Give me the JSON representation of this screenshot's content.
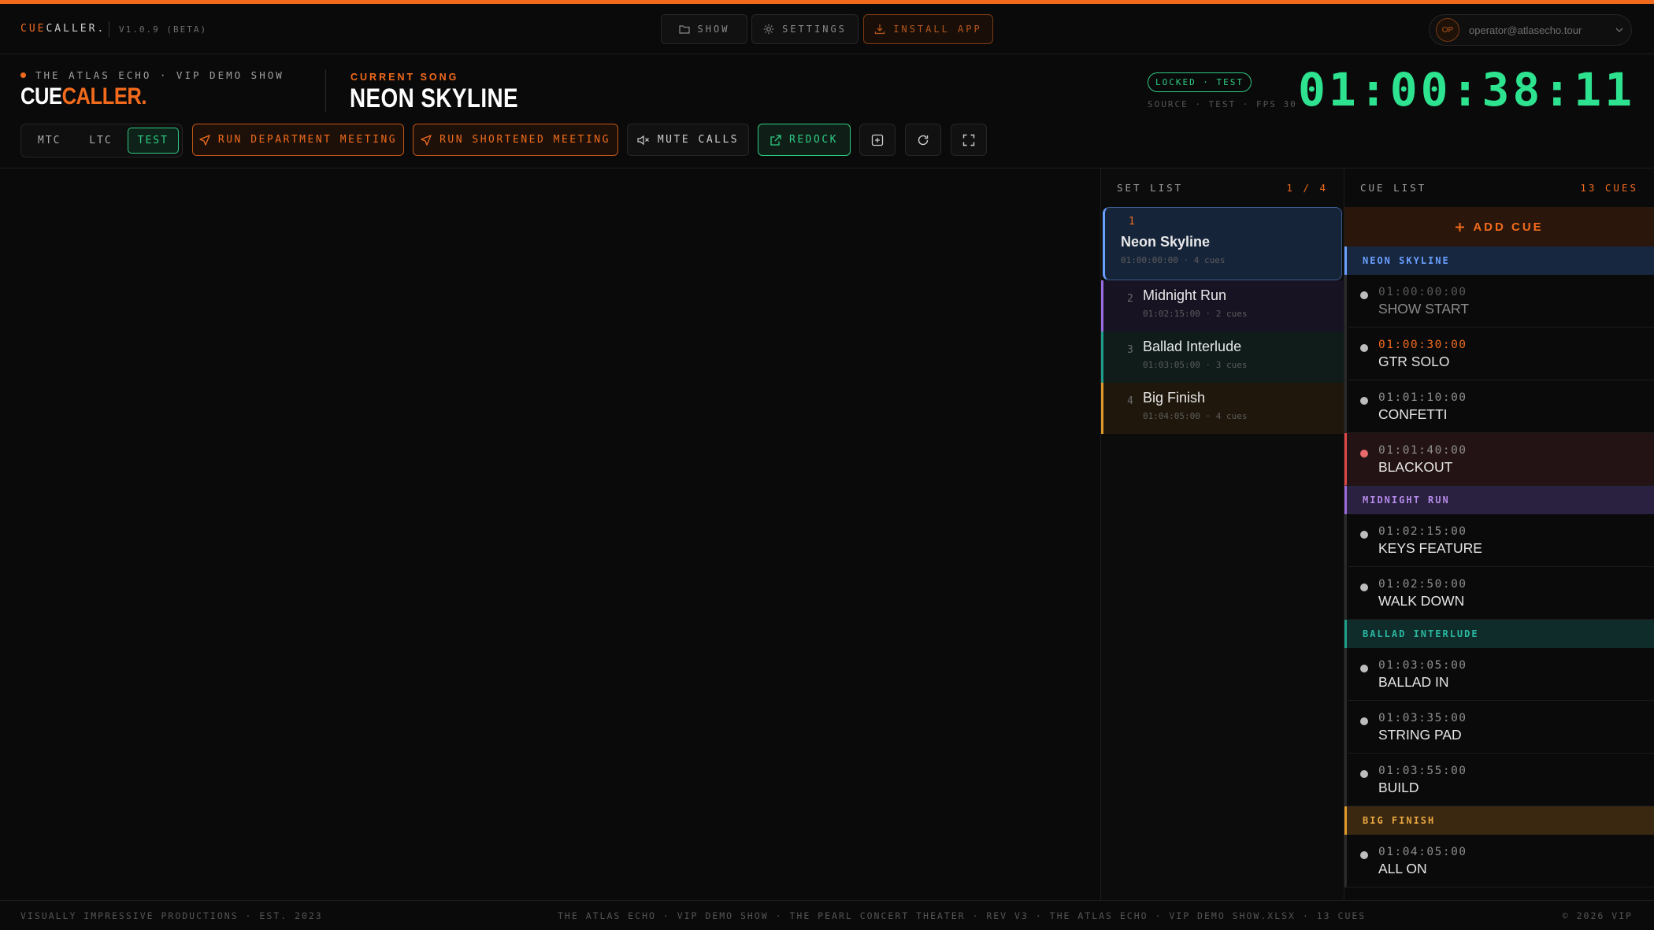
{
  "brand": {
    "small_part1": "CUE",
    "small_part2": "CALLER.",
    "version": "V1.0.9 (BETA)",
    "logo_part1": "CUE",
    "logo_part2": "CALLER."
  },
  "nav": {
    "show": "SHOW",
    "settings": "SETTINGS",
    "install": "INSTALL APP"
  },
  "user": {
    "initials": "OP",
    "email": "operator@atlasecho.tour"
  },
  "show_name": "THE ATLAS ECHO · VIP DEMO SHOW",
  "current_song": {
    "label": "CURRENT SONG",
    "name": "NEON SKYLINE"
  },
  "timecode": {
    "status": "LOCKED · TEST",
    "source": "SOURCE · TEST · FPS 30",
    "value": "01:00:38:11"
  },
  "toolbar": {
    "modes": [
      "MTC",
      "LTC",
      "TEST"
    ],
    "active_mode": "TEST",
    "run_department": "RUN DEPARTMENT MEETING",
    "run_shortened": "RUN SHORTENED MEETING",
    "mute_calls": "MUTE CALLS",
    "redock": "REDOCK"
  },
  "setlist": {
    "title": "SET LIST",
    "count": "1 / 4",
    "items": [
      {
        "num": "1",
        "title": "Neon Skyline",
        "meta": "01:00:00:00 · 4 cues",
        "color": "#6aa0ff"
      },
      {
        "num": "2",
        "title": "Midnight Run",
        "meta": "01:02:15:00 · 2 cues",
        "color": "#9a6bdc"
      },
      {
        "num": "3",
        "title": "Ballad Interlude",
        "meta": "01:03:05:00 · 3 cues",
        "color": "#1f9e8c"
      },
      {
        "num": "4",
        "title": "Big Finish",
        "meta": "01:04:05:00 · 4 cues",
        "color": "#e09a2a"
      }
    ]
  },
  "cuelist": {
    "title": "CUE LIST",
    "count": "13 CUES",
    "add_label": "ADD CUE",
    "groups": [
      {
        "name": "NEON SKYLINE",
        "color": "#6aa0ff",
        "cues": [
          {
            "time": "01:00:00:00",
            "name": "SHOW START",
            "state": "past"
          },
          {
            "time": "01:00:30:00",
            "name": "GTR SOLO",
            "state": "current"
          },
          {
            "time": "01:01:10:00",
            "name": "CONFETTI",
            "state": "normal"
          },
          {
            "time": "01:01:40:00",
            "name": "BLACKOUT",
            "state": "alert"
          }
        ]
      },
      {
        "name": "MIDNIGHT RUN",
        "color": "#9a6bdc",
        "cues": [
          {
            "time": "01:02:15:00",
            "name": "KEYS FEATURE",
            "state": "normal"
          },
          {
            "time": "01:02:50:00",
            "name": "WALK DOWN",
            "state": "normal"
          }
        ]
      },
      {
        "name": "BALLAD INTERLUDE",
        "color": "#1f9e8c",
        "cues": [
          {
            "time": "01:03:05:00",
            "name": "BALLAD IN",
            "state": "normal"
          },
          {
            "time": "01:03:35:00",
            "name": "STRING PAD",
            "state": "normal"
          },
          {
            "time": "01:03:55:00",
            "name": "BUILD",
            "state": "normal"
          }
        ]
      },
      {
        "name": "BIG FINISH",
        "color": "#e09a2a",
        "cues": [
          {
            "time": "01:04:05:00",
            "name": "ALL ON",
            "state": "normal"
          }
        ]
      }
    ]
  },
  "footer": {
    "left": "VISUALLY IMPRESSIVE PRODUCTIONS · EST. 2023",
    "center": "THE ATLAS ECHO · VIP DEMO SHOW · THE PEARL CONCERT THEATER · REV V3 · THE ATLAS ECHO · VIP DEMO SHOW.XLSX · 13 CUES",
    "right": "© 2026 VIP"
  },
  "colors": {
    "accent": "#f26b1d",
    "timecode": "#2ee38f",
    "locked": "#2ecb84",
    "alert": "#e04848"
  }
}
